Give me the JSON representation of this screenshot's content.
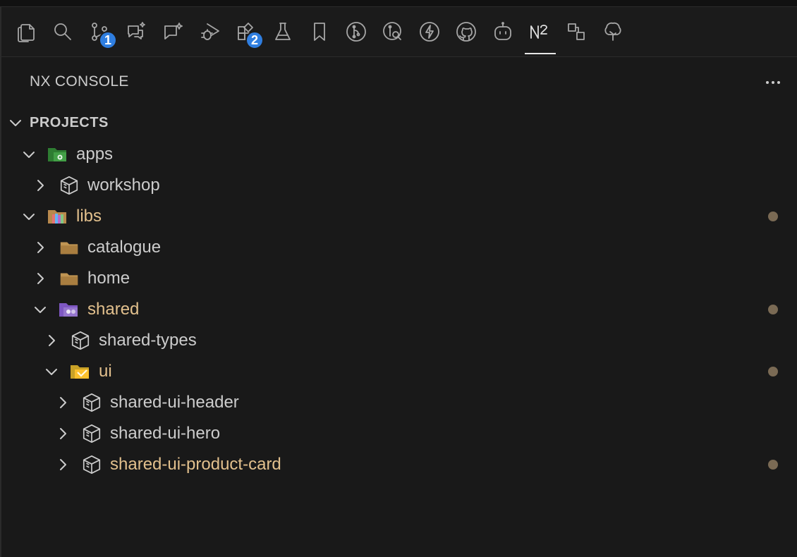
{
  "activity_bar": {
    "items": [
      {
        "name": "explorer-icon"
      },
      {
        "name": "search-icon"
      },
      {
        "name": "source-control-icon",
        "badge": "1"
      },
      {
        "name": "chat-sparkle-icon"
      },
      {
        "name": "copilot-chat-icon"
      },
      {
        "name": "run-debug-icon"
      },
      {
        "name": "extensions-icon",
        "badge": "2"
      },
      {
        "name": "testing-icon"
      },
      {
        "name": "bookmark-icon"
      },
      {
        "name": "git-graph-icon"
      },
      {
        "name": "pull-requests-icon"
      },
      {
        "name": "lightning-icon"
      },
      {
        "name": "github-icon"
      },
      {
        "name": "robot-icon"
      },
      {
        "name": "nx-console-icon",
        "active": true
      },
      {
        "name": "remote-explorer-icon"
      },
      {
        "name": "tree-icon"
      }
    ]
  },
  "panel": {
    "title": "NX CONSOLE",
    "section_title": "PROJECTS"
  },
  "tree": [
    {
      "label": "apps",
      "icon": "folder-apps-icon",
      "expanded": true,
      "modified": false
    },
    {
      "label": "workshop",
      "icon": "project-box-icon",
      "expanded": false,
      "modified": false
    },
    {
      "label": "libs",
      "icon": "folder-libs-icon",
      "expanded": true,
      "modified": true
    },
    {
      "label": "catalogue",
      "icon": "folder-icon",
      "expanded": false,
      "modified": false
    },
    {
      "label": "home",
      "icon": "folder-icon",
      "expanded": false,
      "modified": false
    },
    {
      "label": "shared",
      "icon": "folder-shared-icon",
      "expanded": true,
      "modified": true
    },
    {
      "label": "shared-types",
      "icon": "project-box-icon",
      "expanded": false,
      "modified": false
    },
    {
      "label": "ui",
      "icon": "folder-ui-icon",
      "expanded": true,
      "modified": true
    },
    {
      "label": "shared-ui-header",
      "icon": "project-box-icon",
      "expanded": false,
      "modified": false
    },
    {
      "label": "shared-ui-hero",
      "icon": "project-box-icon",
      "expanded": false,
      "modified": false
    },
    {
      "label": "shared-ui-product-card",
      "icon": "project-box-icon",
      "expanded": false,
      "modified": true
    }
  ],
  "colors": {
    "background": "#191919",
    "text": "#cccccc",
    "modified_text": "#e2c08d",
    "modified_dot": "#7a6a54",
    "badge": "#2f7ee0"
  }
}
